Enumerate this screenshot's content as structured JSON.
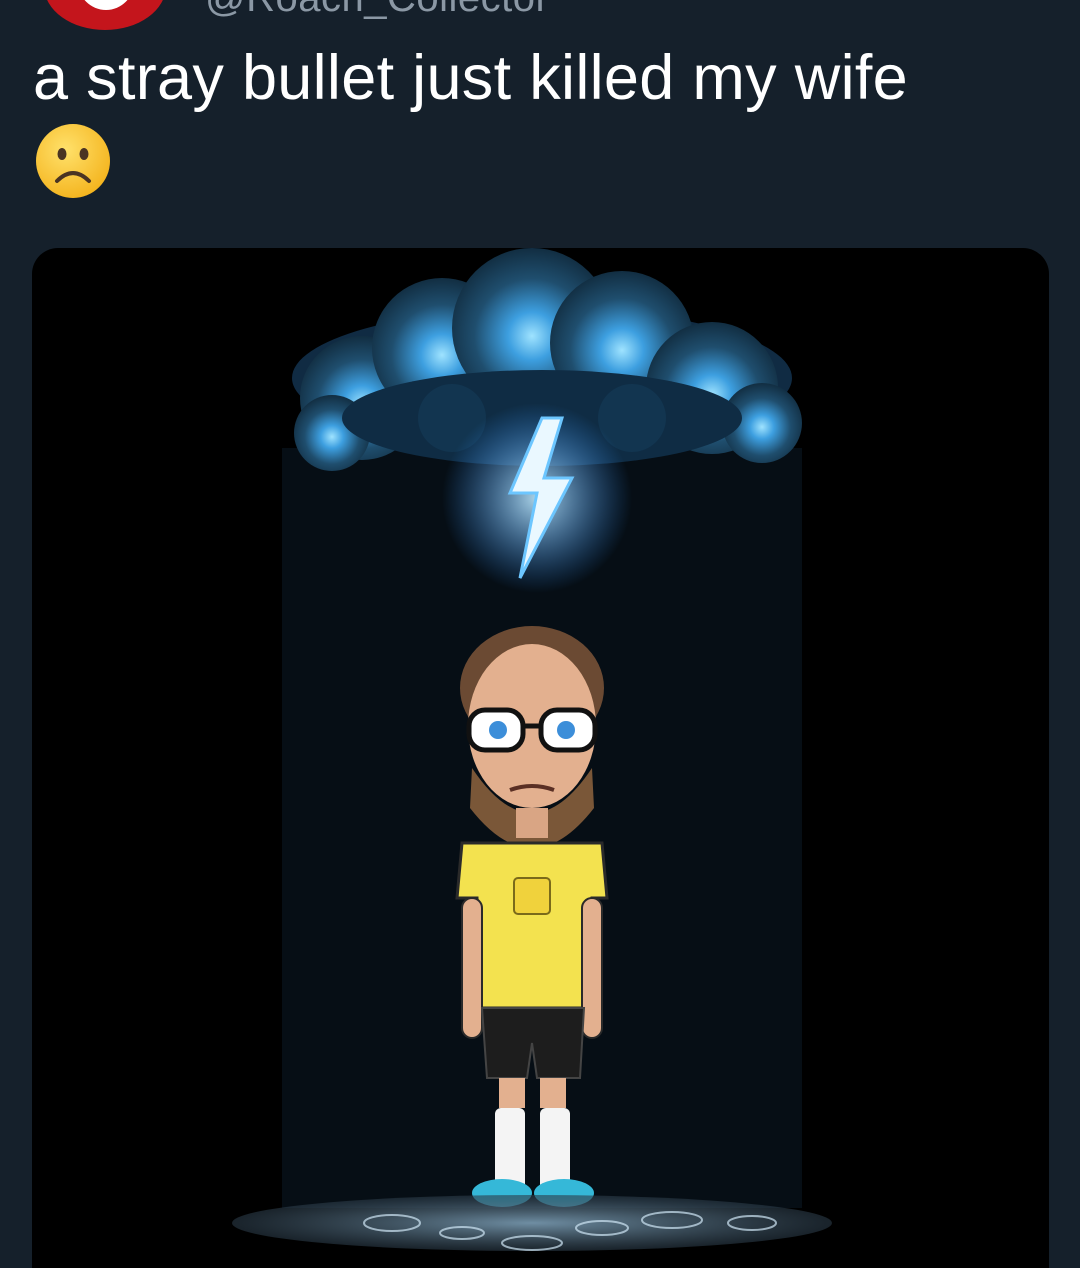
{
  "author": {
    "handle": "@Roach_Collector",
    "avatar_color": "#c4151c"
  },
  "tweet": {
    "text": "a stray bullet just killed my wife",
    "emoji": "slightly-frowning-face"
  },
  "media": {
    "type": "image",
    "subject": "bitmoji-under-rain-cloud",
    "background": "#000000",
    "accent": "#4fb6ff"
  },
  "theme": {
    "background": "#15202b",
    "text": "#ffffff",
    "secondary_text": "#8b98a5"
  }
}
